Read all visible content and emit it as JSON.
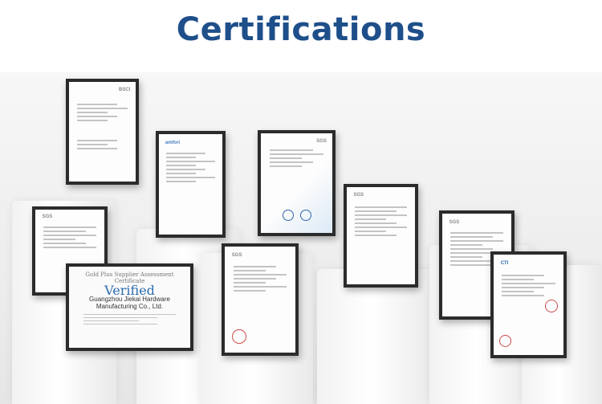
{
  "heading": "Certifications",
  "certificates": [
    {
      "logo": "BSCI"
    },
    {
      "logo": "SGS"
    },
    {
      "logo": "amfori"
    },
    {
      "logo": "SGS"
    },
    {
      "logo": "SGS"
    },
    {
      "logo": "SGS"
    },
    {
      "logo": "SGS"
    },
    {
      "logo": "CTI"
    },
    {
      "header": "Gold Plus Supplier Assessment Certificate",
      "badge": "Verified",
      "company": "Guangzhou Jiekai Hardware Manufacturing Co., Ltd."
    }
  ]
}
